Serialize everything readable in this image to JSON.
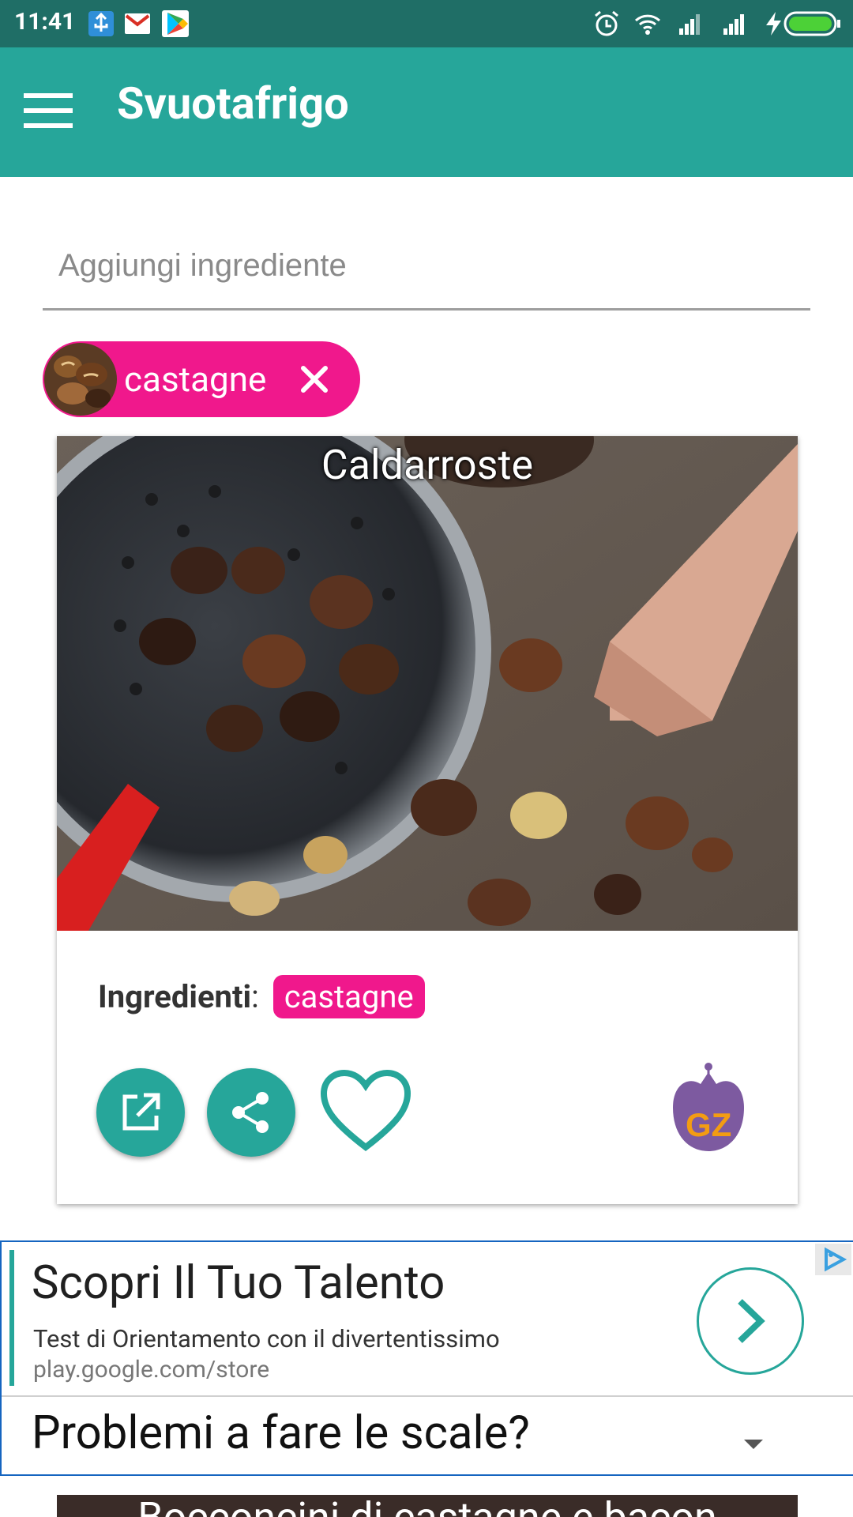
{
  "status": {
    "time": "11:41"
  },
  "app": {
    "title": "Svuotafrigo"
  },
  "search": {
    "placeholder": "Aggiungi ingrediente"
  },
  "chip": {
    "label": "castagne"
  },
  "recipe": {
    "title": "Caldarroste",
    "ingredients_label": "Ingredienti",
    "ingredients_sep": ":",
    "ingredient": "castagne",
    "logo_text": "GZ"
  },
  "ad": {
    "headline": "Scopri Il Tuo Talento",
    "description": "Test di Orientamento con il divertentissimo",
    "url": "play.google.com/store",
    "question": "Problemi a fare le scale?"
  },
  "next_recipe": {
    "title": "Bocconcini di castagne e bacon"
  },
  "colors": {
    "accent": "#26a69a",
    "chip": "#f0188c",
    "statusbar": "#1f6e66",
    "ad_border": "#1565c0"
  }
}
